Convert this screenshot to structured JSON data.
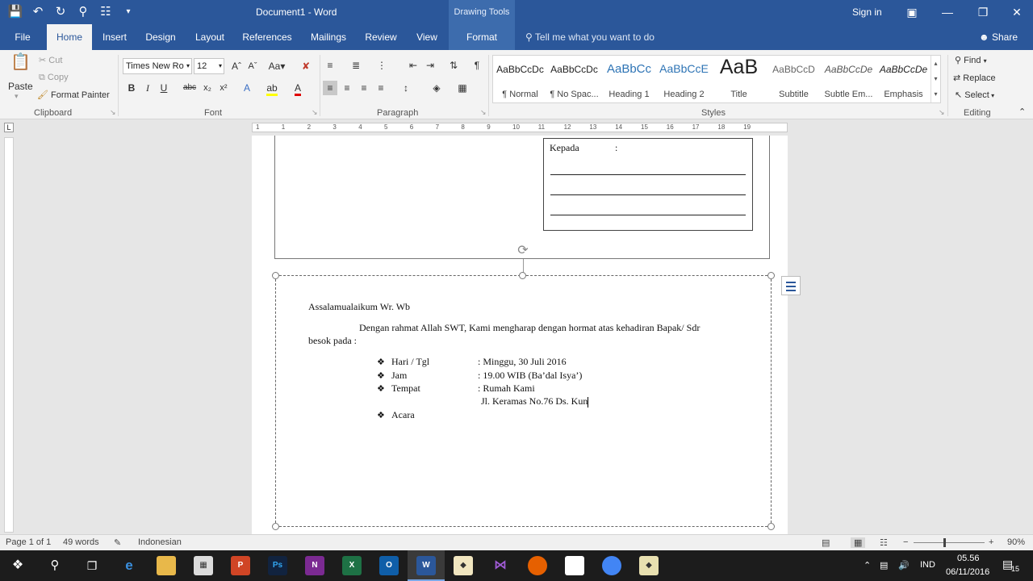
{
  "titlebar": {
    "doc_title": "Document1 - Word",
    "context_tab": "Drawing Tools",
    "signin": "Sign in",
    "qat_icons": [
      "save-icon",
      "undo-icon",
      "redo-icon",
      "touch-mode-icon",
      "print-preview-icon",
      "customize-qat-icon"
    ]
  },
  "tabs": [
    "File",
    "Home",
    "Insert",
    "Design",
    "Layout",
    "References",
    "Mailings",
    "Review",
    "View",
    "Format"
  ],
  "tellme": "Tell me what you want to do",
  "share": "Share",
  "ribbon": {
    "clipboard": {
      "paste": "Paste",
      "cut": "Cut",
      "copy": "Copy",
      "format_painter": "Format Painter",
      "label": "Clipboard"
    },
    "font": {
      "font_name": "Times New Ro",
      "font_size": "12",
      "label": "Font"
    },
    "paragraph": {
      "label": "Paragraph"
    },
    "styles": {
      "label": "Styles",
      "items": [
        {
          "preview": "AaBbCcDc",
          "name": "¶ Normal"
        },
        {
          "preview": "AaBbCcDc",
          "name": "¶ No Spac..."
        },
        {
          "preview": "AaBbCc",
          "name": "Heading 1"
        },
        {
          "preview": "AaBbCcE",
          "name": "Heading 2"
        },
        {
          "preview": "AaB",
          "name": "Title"
        },
        {
          "preview": "AaBbCcD",
          "name": "Subtitle"
        },
        {
          "preview": "AaBbCcDe",
          "name": "Subtle Em..."
        },
        {
          "preview": "AaBbCcDe",
          "name": "Emphasis"
        }
      ]
    },
    "editing": {
      "find": "Find",
      "replace": "Replace",
      "select": "Select",
      "label": "Editing"
    }
  },
  "ruler": {
    "numbers": [
      "1",
      "1",
      "2",
      "3",
      "4",
      "5",
      "6",
      "7",
      "8",
      "9",
      "10",
      "11",
      "12",
      "13",
      "14",
      "15",
      "16",
      "17",
      "18",
      "19"
    ]
  },
  "document": {
    "kepada": "Kepada",
    "kepada_colon": ":",
    "greeting": "Assalamualaikum Wr. Wb",
    "para_line1": "Dengan rahmat Allah SWT, Kami mengharap dengan hormat atas kehadiran Bapak/ Sdr",
    "para_line2": "besok pada :",
    "details": [
      {
        "label": "Hari / Tgl",
        "value": ": Minggu, 30 Juli 2016"
      },
      {
        "label": "Jam",
        "value": ": 19.00 WIB (Ba’dal Isya’)"
      },
      {
        "label": "Tempat",
        "value": ": Rumah Kami"
      }
    ],
    "address": "Jl. Keramas No.76 Ds. Kun",
    "acara": "Acara",
    "bullet_char": "❖"
  },
  "statusbar": {
    "page": "Page 1 of 1",
    "words": "49 words",
    "language": "Indonesian",
    "zoom": "90%"
  },
  "taskbar": {
    "lang": "IND",
    "time": "05.56",
    "date": "06/11/2016",
    "notification_count": "15"
  }
}
